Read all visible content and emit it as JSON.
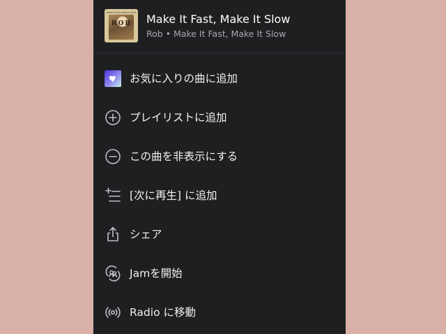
{
  "track": {
    "title": "Make It Fast, Make It Slow",
    "subtitle": "Rob • Make It Fast, Make It Slow",
    "cover_text_top": "MAKE IT FAST, MAKE IT SLOW",
    "cover_text_main": "ROB"
  },
  "menu": {
    "items": [
      {
        "label": "お気に入りの曲に追加",
        "icon": "liked-songs-heart-icon"
      },
      {
        "label": "プレイリストに追加",
        "icon": "plus-circle-icon"
      },
      {
        "label": "この曲を非表示にする",
        "icon": "minus-circle-icon"
      },
      {
        "label": "[次に再生] に追加",
        "icon": "add-to-queue-icon"
      },
      {
        "label": "シェア",
        "icon": "share-icon"
      },
      {
        "label": "Jamを開始",
        "icon": "jam-icon"
      },
      {
        "label": "Radio に移動",
        "icon": "radio-icon"
      }
    ]
  },
  "colors": {
    "page_background": "#d8b0a7",
    "sheet_background": "#1e1f21",
    "text_primary": "#ffffff",
    "text_secondary": "#a7a9ad",
    "liked_gradient_start": "#4c34d9",
    "liked_gradient_end": "#c4eee9"
  }
}
